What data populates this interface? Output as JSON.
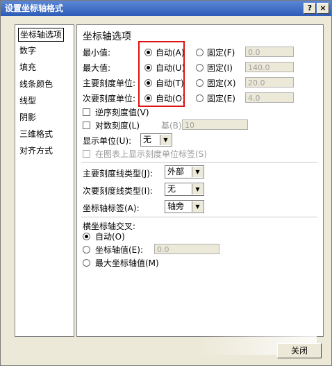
{
  "window": {
    "title": "设置坐标轴格式",
    "help_icon": "?",
    "close_icon": "×"
  },
  "sidebar": {
    "items": [
      {
        "label": "坐标轴选项",
        "active": true
      },
      {
        "label": "数字"
      },
      {
        "label": "填充"
      },
      {
        "label": "线条颜色"
      },
      {
        "label": "线型"
      },
      {
        "label": "阴影"
      },
      {
        "label": "三维格式"
      },
      {
        "label": "对齐方式"
      }
    ]
  },
  "main": {
    "heading": "坐标轴选项",
    "rows": [
      {
        "label": "最小值:",
        "auto": "自动(A)",
        "fixed": "固定(F)",
        "value": "0.0"
      },
      {
        "label": "最大值:",
        "auto": "自动(U)",
        "fixed": "固定(I)",
        "value": "140.0"
      },
      {
        "label": "主要刻度单位:",
        "auto": "自动(T)",
        "fixed": "固定(X)",
        "value": "20.0"
      },
      {
        "label": "次要刻度单位:",
        "auto": "自动(O)",
        "fixed": "固定(E)",
        "value": "4.0"
      }
    ],
    "reverse_label": "逆序刻度值(V)",
    "log_label": "对数刻度(L)",
    "log_base_label": "基(B):",
    "log_base_value": "10",
    "display_unit_label": "显示单位(U):",
    "display_unit_value": "无",
    "show_unit_label": "在图表上显示刻度单位标签(S)",
    "major_tick_label": "主要刻度线类型(J):",
    "major_tick_value": "外部",
    "minor_tick_label": "次要刻度线类型(I):",
    "minor_tick_value": "无",
    "axis_label_label": "坐标轴标签(A):",
    "axis_label_value": "轴旁",
    "cross_heading": "横坐标轴交叉:",
    "cross_auto": "自动(O)",
    "cross_value_label": "坐标轴值(E):",
    "cross_value": "0.0",
    "cross_max": "最大坐标轴值(M)"
  },
  "footer": {
    "close_label": "关闭"
  }
}
